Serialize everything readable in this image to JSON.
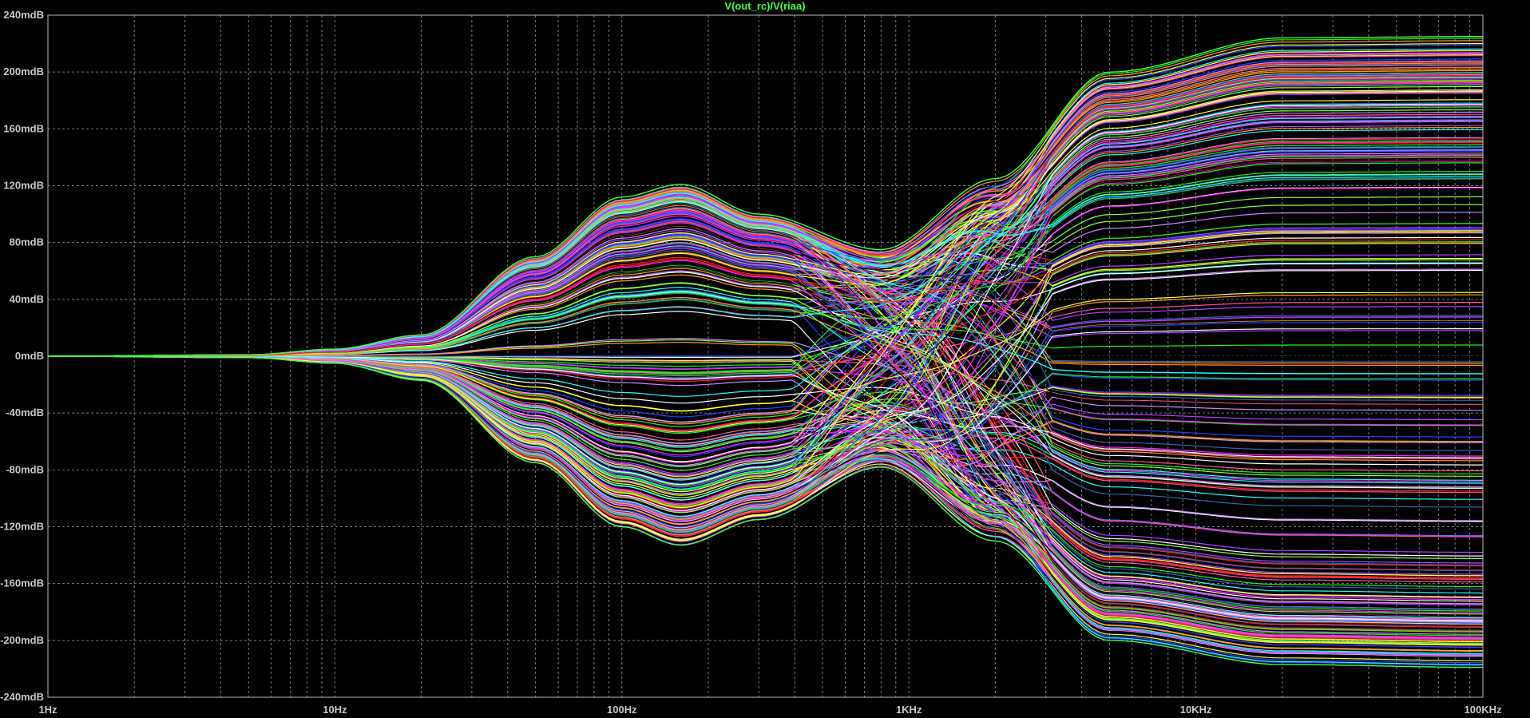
{
  "window": {
    "trace_title": "V(out_rc)/V(riaa)",
    "trace_title_color": "#44ff44",
    "background_color": "#000000",
    "grid_color": "#7a7a7a",
    "axis_label_color": "#c8c8c8"
  },
  "chart_data": {
    "type": "line",
    "title": "V(out_rc)/V(riaa)",
    "xlabel": "",
    "ylabel": "",
    "x_scale": "log",
    "xlim": [
      1,
      100000
    ],
    "ylim": [
      -240,
      240
    ],
    "y_unit": "mdB",
    "grid": true,
    "x_tick_labels": [
      "1Hz",
      "10Hz",
      "100Hz",
      "1KHz",
      "10KHz",
      "100KHz"
    ],
    "x_tick_values": [
      1,
      10,
      100,
      1000,
      10000,
      100000
    ],
    "y_tick_labels": [
      "240mdB",
      "200mdB",
      "160mdB",
      "120mdB",
      "80mdB",
      "40mdB",
      "0mdB",
      "-40mdB",
      "-80mdB",
      "-120mdB",
      "-160mdB",
      "-200mdB",
      "-240mdB"
    ],
    "y_tick_values": [
      240,
      200,
      160,
      120,
      80,
      40,
      0,
      -40,
      -80,
      -120,
      -160,
      -200,
      -240
    ],
    "series_palette": [
      "#ff2222",
      "#22ee22",
      "#2244ff",
      "#ff22ff",
      "#22ffff",
      "#ffff33",
      "#ff9922",
      "#aa44ff",
      "#ffffff",
      "#ff5599",
      "#88ff44",
      "#000000",
      "#3366aa",
      "#cc88ff"
    ],
    "series_count": 300,
    "envelope": {
      "x": [
        1,
        5,
        10,
        20,
        50,
        100,
        160,
        300,
        800,
        2000,
        5000,
        20000,
        100000
      ],
      "upper": [
        0,
        1,
        5,
        15,
        70,
        112,
        121,
        100,
        75,
        125,
        200,
        224,
        225
      ],
      "lower": [
        0,
        -1,
        -5,
        -17,
        -75,
        -120,
        -133,
        -115,
        -78,
        -130,
        -200,
        -217,
        -219
      ]
    }
  }
}
